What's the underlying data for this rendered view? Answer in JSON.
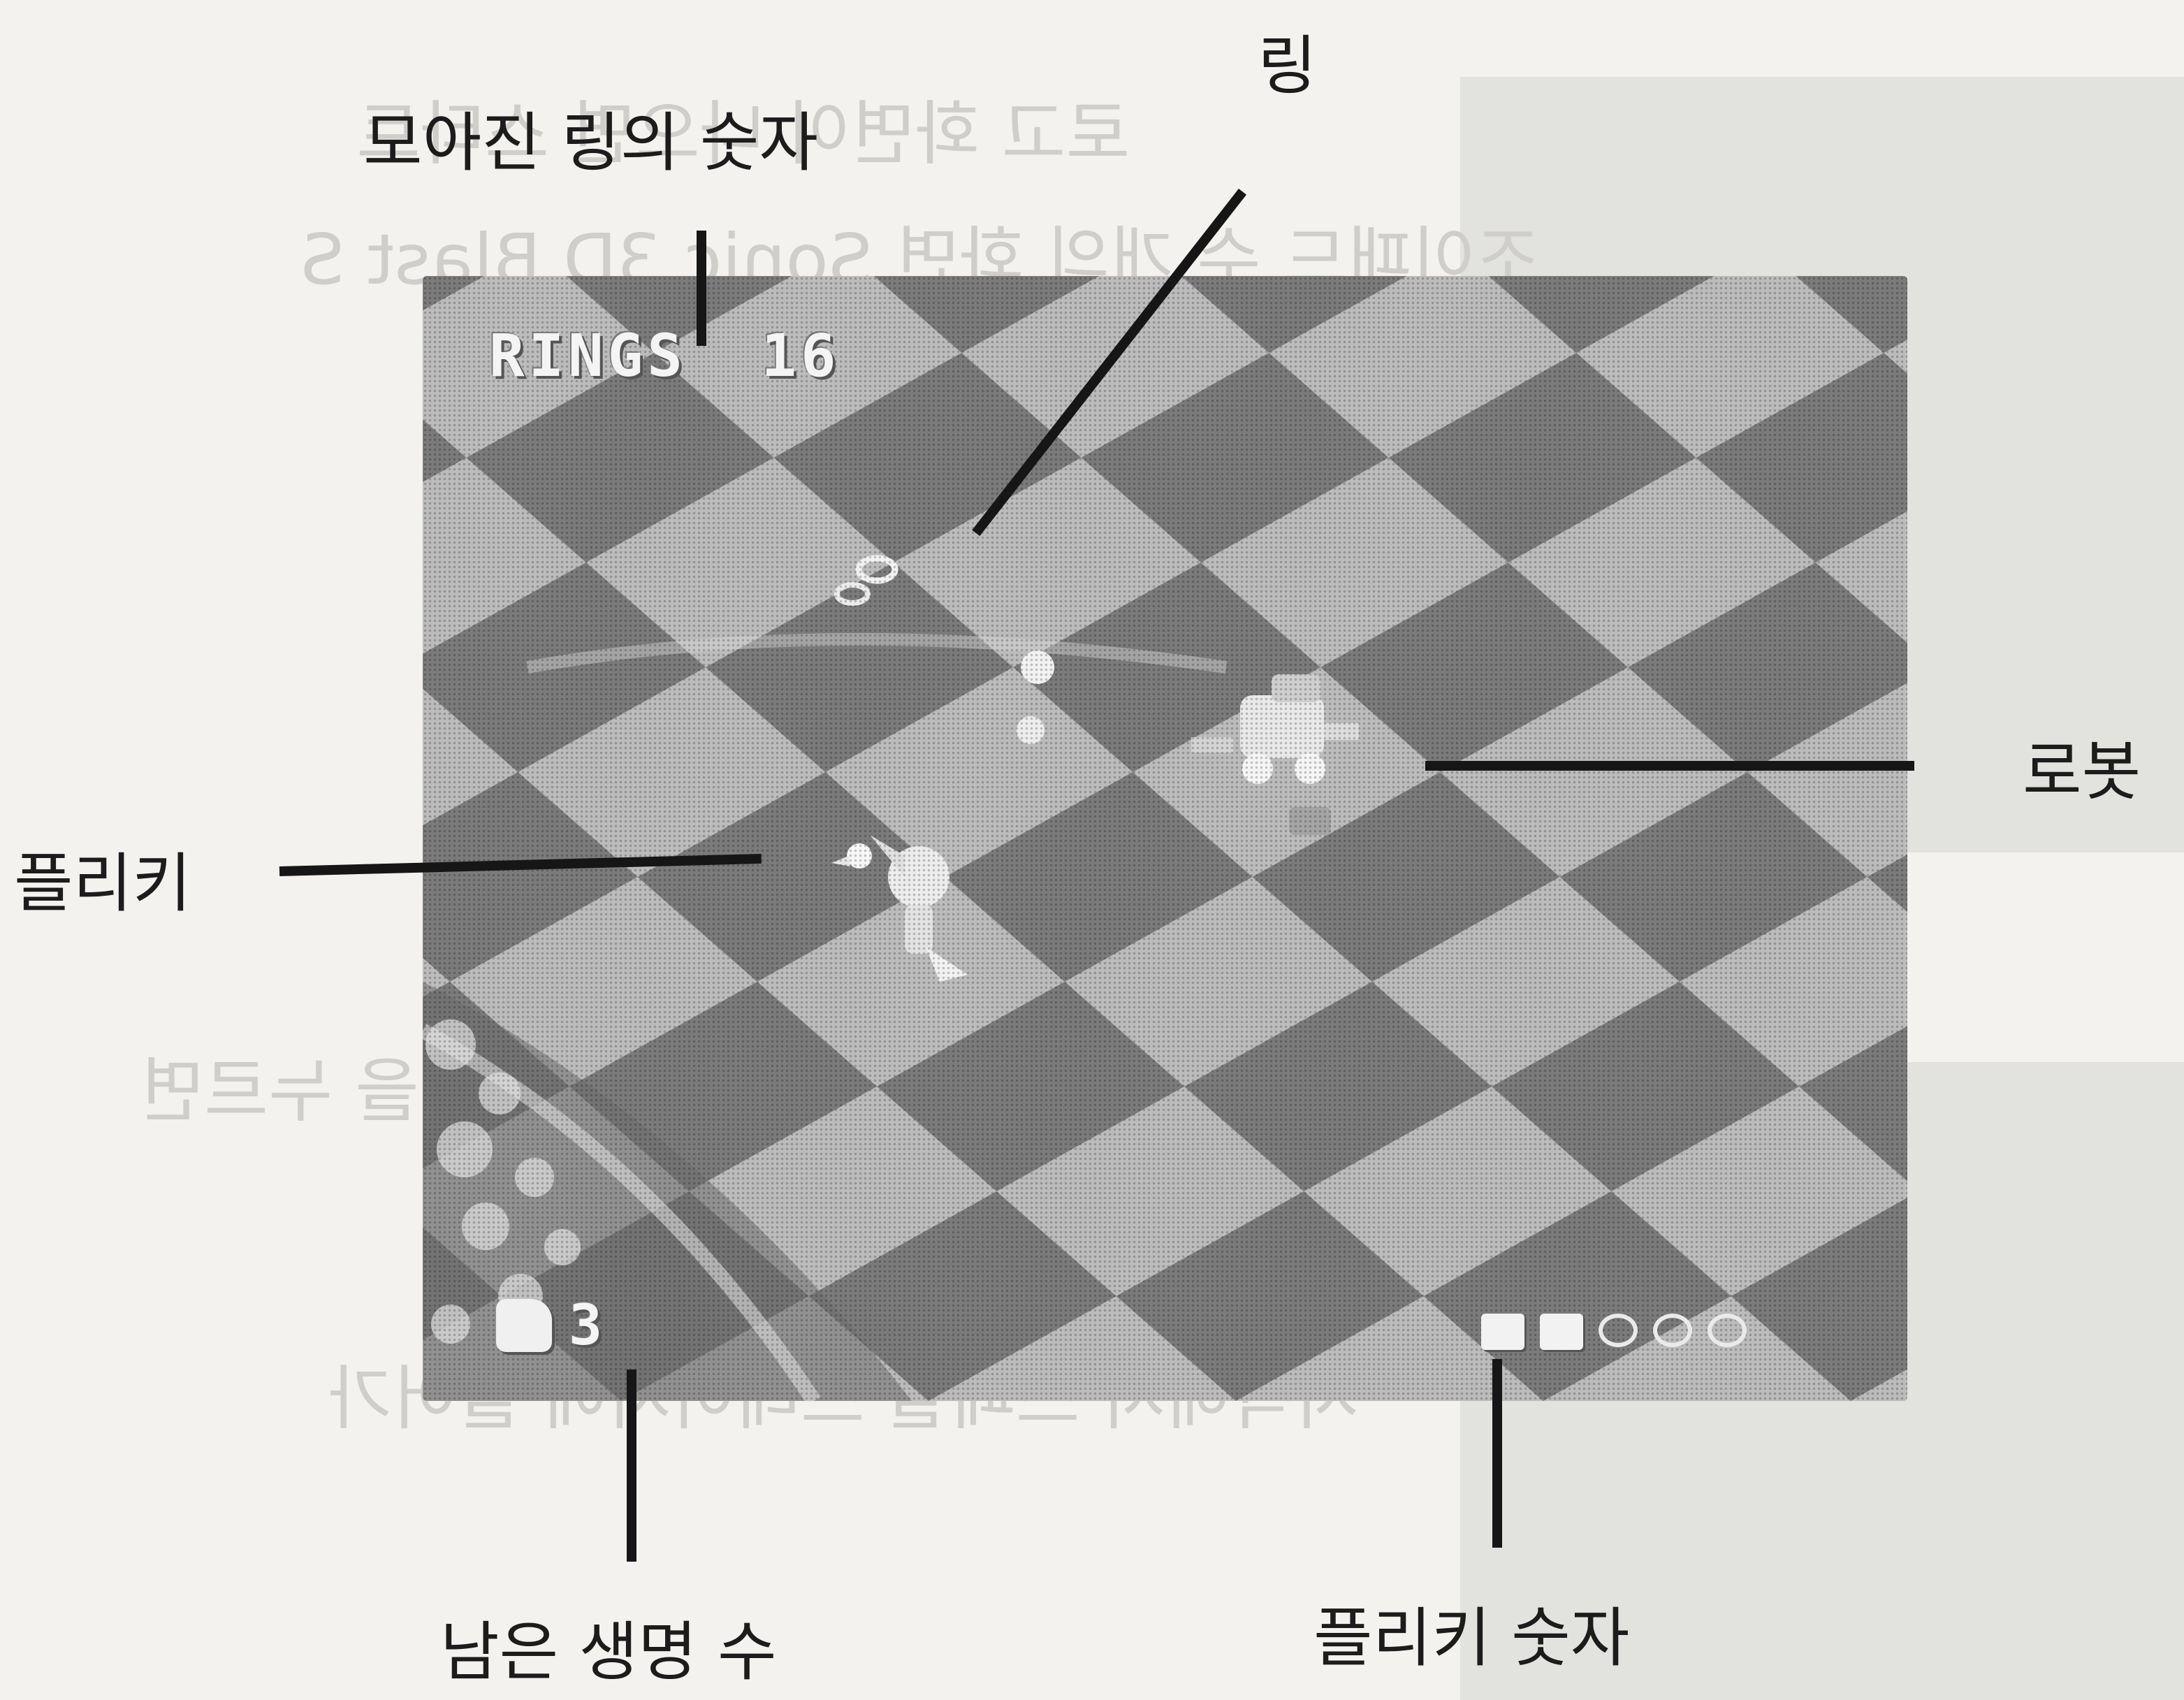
{
  "labels": {
    "ring_count": "모아진 링의 숫자",
    "ring": "링",
    "robot": "로봇",
    "flicky": "플리키",
    "lives_left": "남은 생명 수",
    "flicky_count": "플리키 숫자"
  },
  "hud": {
    "rings_label": "RINGS",
    "rings_value": "16",
    "lives_value": "3"
  },
  "icons": {
    "lives": "sonic-head-icon",
    "flicky_slots": [
      "flicky-collected-icon",
      "flicky-collected-icon",
      "flicky-empty-icon",
      "flicky-empty-icon",
      "flicky-empty-icon"
    ]
  },
  "colors": {
    "page": "#f3f2ef",
    "tile_light": "#bdbdbd",
    "tile_dark": "#7a7a7a",
    "ink": "#161616"
  }
}
